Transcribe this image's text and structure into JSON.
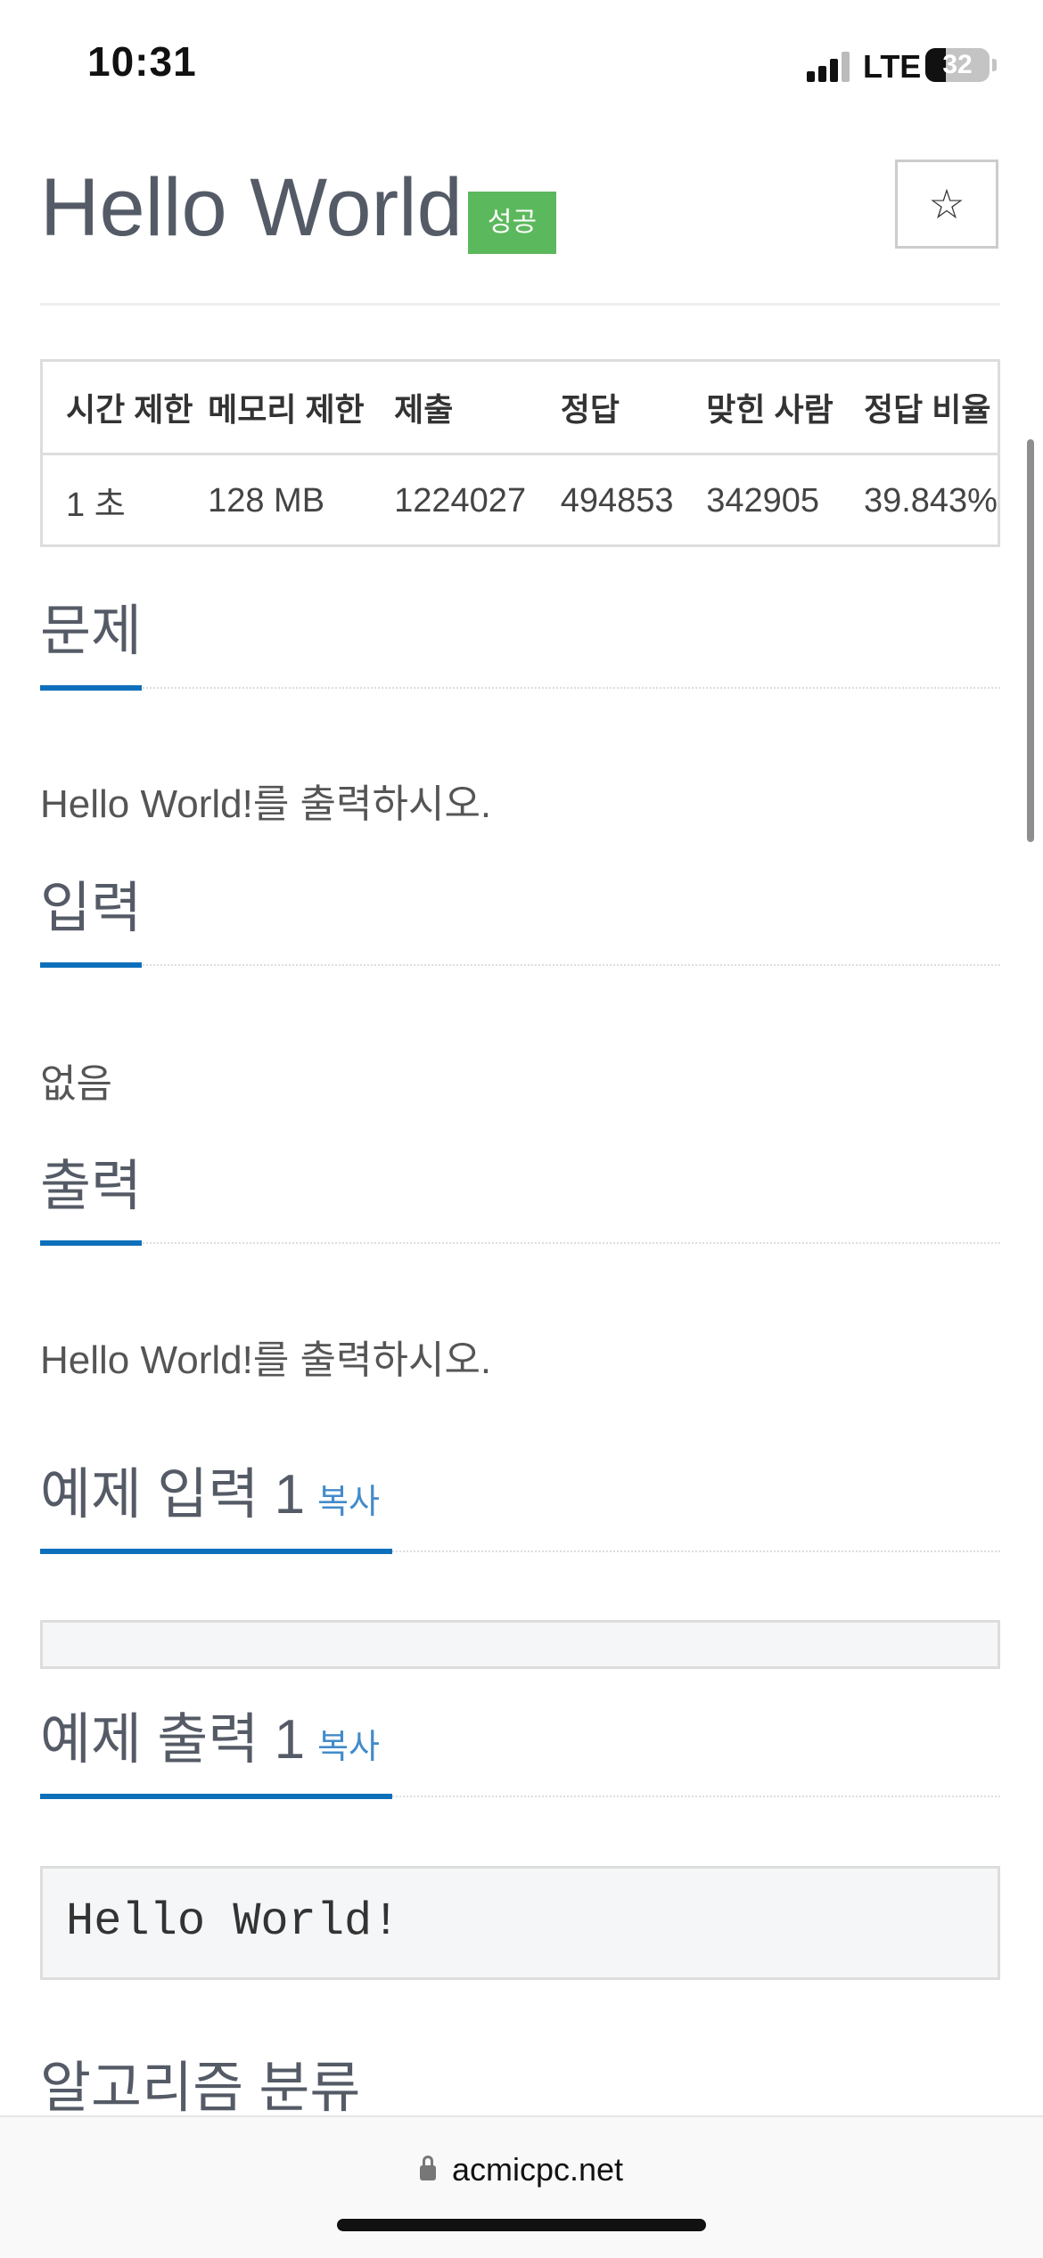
{
  "status_bar": {
    "time": "10:31",
    "network": "LTE",
    "battery": "32",
    "battery_level": 0.32
  },
  "problem": {
    "title": "Hello World",
    "badge": "성공",
    "star_icon": "☆"
  },
  "stats": {
    "headers": [
      "시간 제한",
      "메모리 제한",
      "제출",
      "정답",
      "맞힌 사람",
      "정답 비율"
    ],
    "values": [
      "1 초",
      "128 MB",
      "1224027",
      "494853",
      "342905",
      "39.843%"
    ]
  },
  "sections": {
    "description": {
      "heading": "문제",
      "text": "Hello World!를 출력하시오."
    },
    "input": {
      "heading": "입력",
      "text": "없음"
    },
    "output": {
      "heading": "출력",
      "text": "Hello World!를 출력하시오."
    },
    "sample_input": {
      "heading": "예제 입력 1",
      "copy": "복사",
      "content": ""
    },
    "sample_output": {
      "heading": "예제 출력 1",
      "copy": "복사",
      "content": "Hello World!"
    },
    "algorithm": {
      "heading": "알고리즘 분류"
    }
  },
  "browser": {
    "url": "acmicpc.net"
  }
}
